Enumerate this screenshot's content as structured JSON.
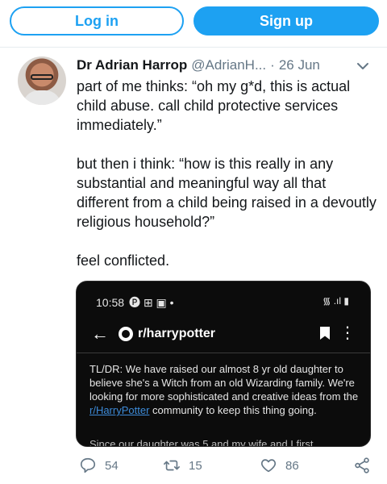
{
  "header": {
    "login_label": "Log in",
    "signup_label": "Sign up"
  },
  "tweet": {
    "author_name": "Dr Adrian Harrop",
    "author_handle": "@AdrianH...",
    "separator": "·",
    "date": "26 Jun",
    "paragraphs": [
      "part of me thinks: “oh my g*d, this is actual child abuse. call child protective services immediately.”",
      "but then i think: “how is this really in any substantial and meaningful way all that different from a child being raised in a devoutly religious household?”",
      "feel conflicted."
    ],
    "media": {
      "time": "10:58",
      "status_icons_left": "🅟 ⊞ ▣ •",
      "status_icons_right": "᯾ .ıl ▮",
      "subreddit": "r/harrypotter",
      "post_text_1": "TL/DR: We have raised our almost 8 yr old daughter to believe she's a Witch from an old Wizarding family. We're looking for more sophisticated and creative ideas from the ",
      "post_link": "r/HarryPotter",
      "post_text_2": " community to keep this thing going.",
      "post_text_cut": "Since our daughter was 5 and my wife and I first"
    },
    "actions": {
      "replies": "54",
      "retweets": "15",
      "likes": "86"
    }
  },
  "colors": {
    "accent": "#1da1f2",
    "muted": "#657786",
    "text": "#14171a"
  },
  "icons": [
    "chevron-down-icon",
    "reply-icon",
    "retweet-icon",
    "like-icon",
    "share-icon",
    "back-arrow-icon",
    "bookmark-icon",
    "more-vertical-icon"
  ]
}
